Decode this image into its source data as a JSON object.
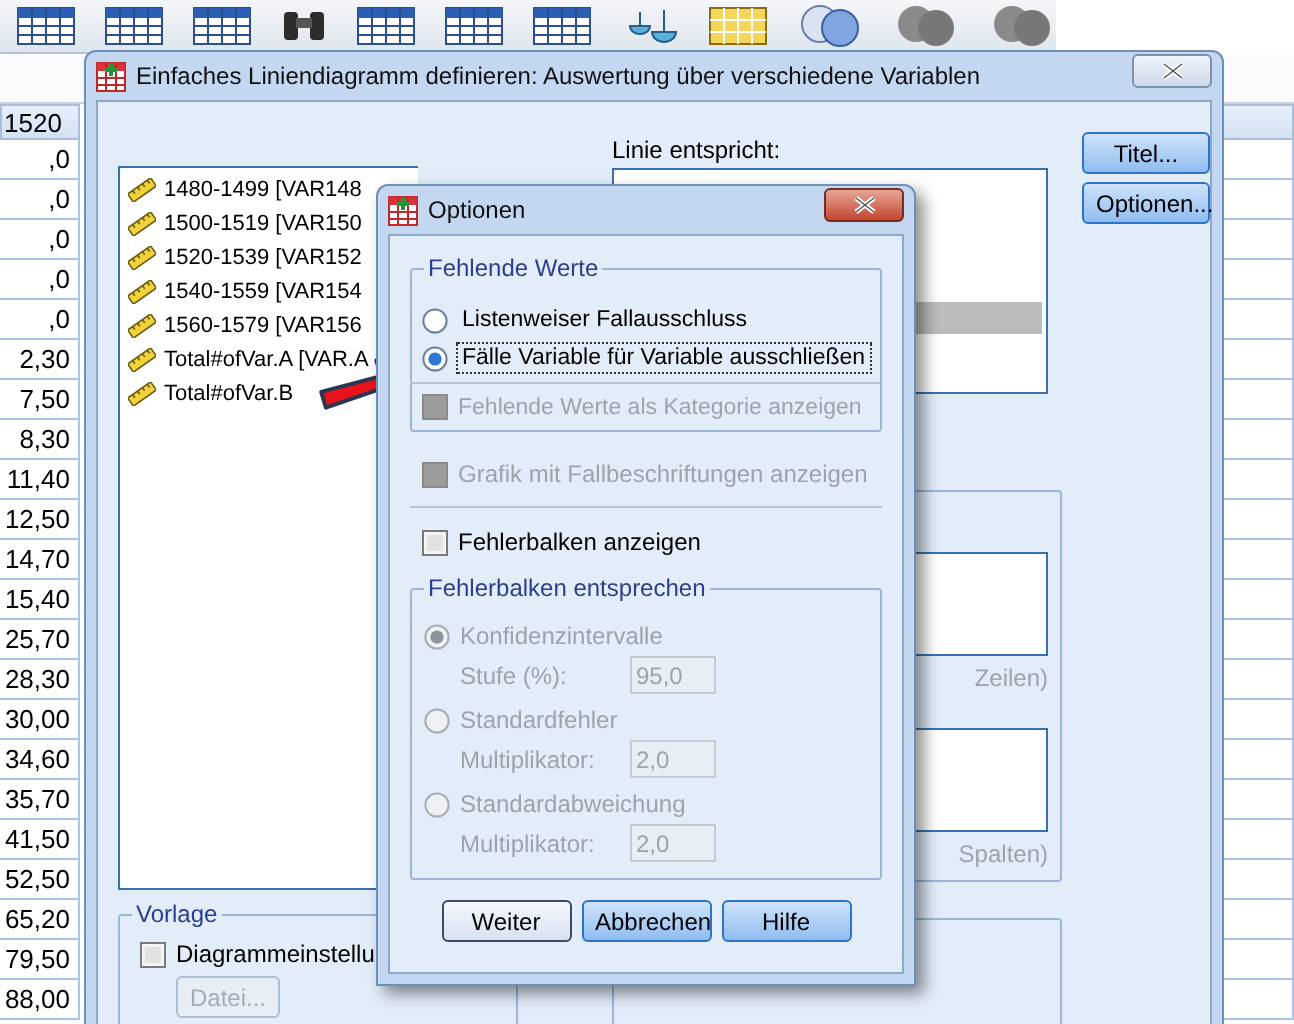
{
  "spreadsheet": {
    "column_header": "1520",
    "cells": [
      ",0",
      ",0",
      ",0",
      ",0",
      ",0",
      "2,30",
      "7,50",
      "8,30",
      "11,40",
      "12,50",
      "14,70",
      "15,40",
      "25,70",
      "28,30",
      "30,00",
      "34,60",
      "35,70",
      "41,50",
      "52,50",
      "65,20",
      "79,50",
      "88,00"
    ]
  },
  "main_dialog": {
    "title": "Einfaches Liniendiagramm definieren: Auswertung über verschiedene Variablen",
    "variables": [
      {
        "label": "1480-1499 [VAR148"
      },
      {
        "label": "1500-1519 [VAR150"
      },
      {
        "label": "1520-1539 [VAR152"
      },
      {
        "label": "1540-1559 [VAR154"
      },
      {
        "label": "1560-1579 [VAR156"
      },
      {
        "label": "Total#ofVar.A [VAR.A"
      },
      {
        "label": "Total#ofVar.B"
      }
    ],
    "line_label": "Linie entspricht:",
    "buttons": [
      {
        "label": "Titel..."
      },
      {
        "label": "Optionen..."
      }
    ],
    "panel_captions": [
      "Zeilen)",
      "Spalten)"
    ],
    "template": {
      "title": "Vorlage",
      "checkbox": {
        "label": "Diagrammeinstellu",
        "checked": false
      },
      "file_button": {
        "label": "Datei...",
        "disabled": true
      }
    }
  },
  "options_dialog": {
    "title": "Optionen",
    "missing_values": {
      "title": "Fehlende Werte",
      "options": [
        {
          "label": "Listenweiser Fallausschluss",
          "selected": false
        },
        {
          "label": "Fälle Variable für Variable ausschließen",
          "selected": true
        }
      ],
      "checkbox": {
        "label": "Fehlende Werte als Kategorie anzeigen",
        "checked": false,
        "disabled": true
      }
    },
    "case_labels": {
      "label": "Grafik mit Fallbeschriftungen anzeigen",
      "checked": false,
      "disabled": true
    },
    "error_bars": {
      "label": "Fehlerbalken anzeigen",
      "checked": false,
      "disabled": false
    },
    "error_group": {
      "title": "Fehlerbalken entsprechen",
      "disabled": true,
      "options": [
        {
          "label": "Konfidenzintervalle",
          "selected": true,
          "field_label": "Stufe (%):",
          "value": "95,0"
        },
        {
          "label": "Standardfehler",
          "selected": false,
          "field_label": "Multiplikator:",
          "value": "2,0"
        },
        {
          "label": "Standardabweichung",
          "selected": false,
          "field_label": "Multiplikator:",
          "value": "2,0"
        }
      ]
    },
    "buttons": [
      {
        "label": "Weiter",
        "default": true
      },
      {
        "label": "Abbrechen",
        "default": false
      },
      {
        "label": "Hilfe",
        "default": false
      }
    ]
  }
}
